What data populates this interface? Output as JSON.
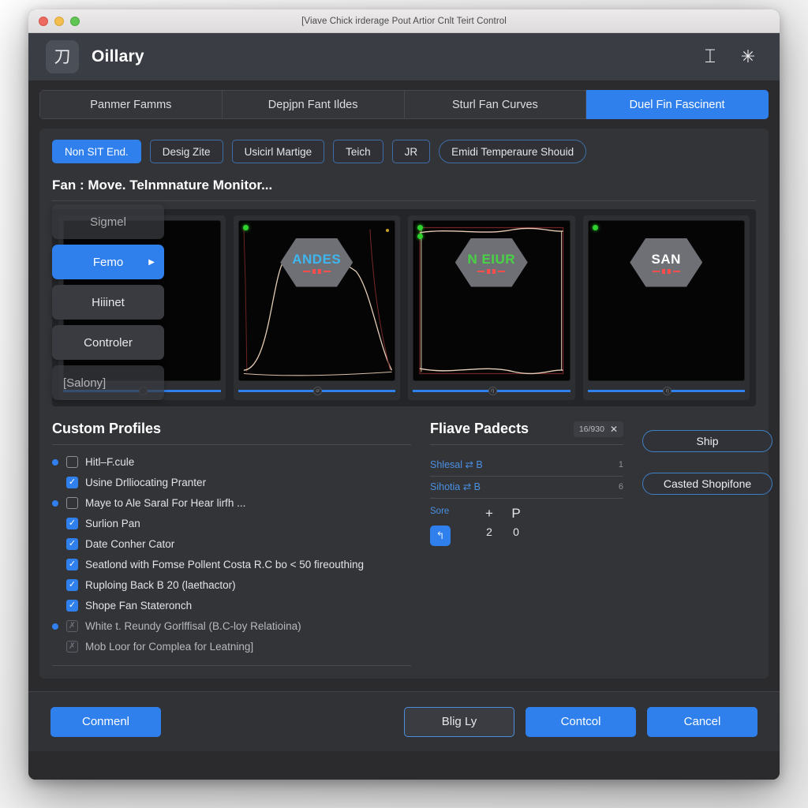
{
  "window": {
    "title": "[Viave Chick irderage Pout Artior Cnlt Teirt Control",
    "traffic": {
      "close": "close-button",
      "minimize": "minimize-button",
      "zoom": "zoom-button"
    }
  },
  "header": {
    "logo_glyph": "刀",
    "app_title": "Oillary",
    "icons": [
      {
        "name": "text-cursor-icon",
        "glyph": "⌶"
      },
      {
        "name": "asterisk-icon",
        "glyph": "✳"
      }
    ]
  },
  "tabs": [
    {
      "label": "Panmer Famms",
      "active": false
    },
    {
      "label": "Depjpn Fant Ildes",
      "active": false
    },
    {
      "label": "Sturl Fan Curves",
      "active": false
    },
    {
      "label": "Duel Fin Fascinent",
      "active": true
    }
  ],
  "chips": [
    {
      "label": "Non SIT End.",
      "style": "primary"
    },
    {
      "label": "Desig Zite",
      "style": "outline"
    },
    {
      "label": "Usicirl Martige",
      "style": "outline"
    },
    {
      "label": "Teich",
      "style": "outline"
    },
    {
      "label": "JR",
      "style": "outline"
    },
    {
      "label": "Emidi Temperaure Shouid",
      "style": "pill"
    }
  ],
  "monitor": {
    "section_title": "Fan : Move. Telnmnature Monitor...",
    "cards": [
      {
        "badge": "",
        "badge_color": "none",
        "slider_knob": ""
      },
      {
        "badge": "ANDES",
        "badge_color": "cyan",
        "slider_knob": "cr"
      },
      {
        "badge": "N EIUR",
        "badge_color": "green",
        "slider_knob": "r)"
      },
      {
        "badge": "SAN",
        "badge_color": "white",
        "slider_knob": "r)"
      }
    ]
  },
  "dropdown": {
    "items": [
      {
        "label": "Sigmel",
        "active": false,
        "arrow": ""
      },
      {
        "label": "Femo",
        "active": true,
        "arrow": "▶"
      },
      {
        "label": "Hiiinet",
        "active": false,
        "arrow": ""
      },
      {
        "label": "Controler",
        "active": false,
        "arrow": ""
      },
      {
        "label": "[Salony]",
        "active": false,
        "arrow": ""
      }
    ]
  },
  "profiles": {
    "title": "Custom Profiles",
    "items": [
      {
        "bullet": true,
        "state": "unchecked",
        "label": "Hitl–F.cule"
      },
      {
        "bullet": false,
        "state": "checked",
        "label": "Usine Drlliocating Pranter"
      },
      {
        "bullet": true,
        "state": "unchecked",
        "label": "Maye to Ale Saral For Hear lirfh ..."
      },
      {
        "bullet": false,
        "state": "checked",
        "label": "Surlion Pan"
      },
      {
        "bullet": false,
        "state": "checked",
        "label": "Date Conher Cator"
      },
      {
        "bullet": false,
        "state": "checked",
        "label": "Seatlond with Fomse Pollent Costa R.C bo < 50 fireouthing"
      },
      {
        "bullet": false,
        "state": "checked",
        "label": "Ruploing Back  B 20 (laethactor)"
      },
      {
        "bullet": false,
        "state": "checked",
        "label": "Shope Fan Stateronch"
      },
      {
        "bullet": true,
        "state": "disabled",
        "label": "White t. Reundy Gorlffisal (B.C-loy Relatioina)"
      },
      {
        "bullet": false,
        "state": "disabled",
        "label": "Mob Loor for Complea for Leatning]"
      }
    ]
  },
  "packets": {
    "title": "Fliave Padects",
    "badge": "16/930",
    "badge_close": "✕",
    "rows": [
      {
        "label": "Shlesal ⇄ B",
        "value": "1"
      },
      {
        "label": "Sihotia ⇄ B",
        "value": "6"
      }
    ],
    "footer": {
      "key": "Sore",
      "plus": "+",
      "p": "P",
      "button_glyph": "↰",
      "num_left": "2",
      "num_right": "0"
    }
  },
  "side_actions": [
    {
      "label": "Ship"
    },
    {
      "label": "Casted Shopifone"
    }
  ],
  "footer_buttons": [
    {
      "label": "Conmenl",
      "style": "primary"
    },
    {
      "label": "Blig Ly",
      "style": "ghost"
    },
    {
      "label": "Contcol",
      "style": "primary"
    },
    {
      "label": "Cancel",
      "style": "primary"
    }
  ],
  "colors": {
    "accent": "#2f80ed",
    "window_bg": "#2b2b2e",
    "panel_bg": "#333438",
    "header_bg": "#3a3d44",
    "led_green": "#2dd22d",
    "badge_cyan": "#3fb6f0",
    "badge_green": "#4ad246"
  }
}
